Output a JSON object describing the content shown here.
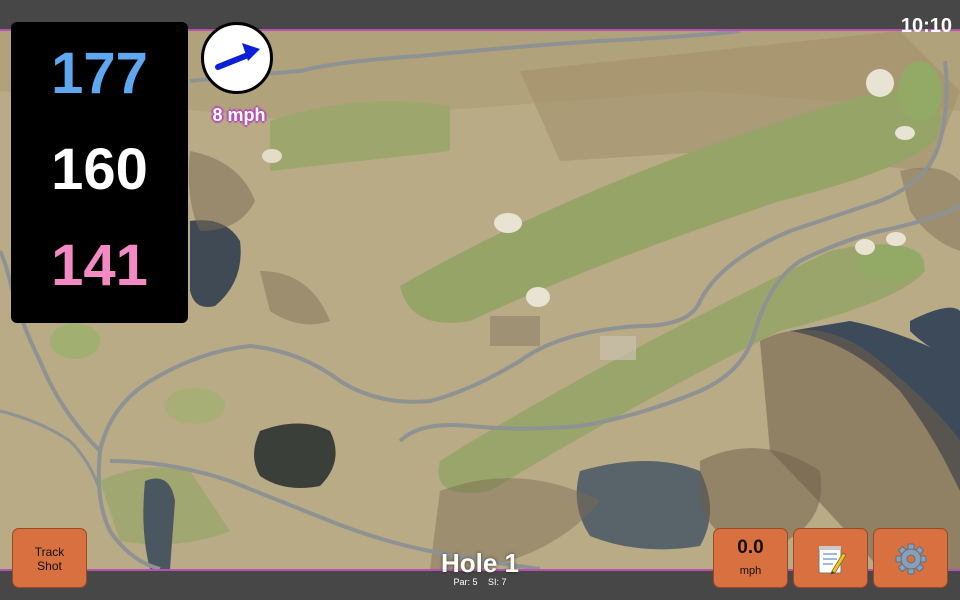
{
  "clock": "10:10",
  "distances": {
    "back": "177",
    "middle": "160",
    "front": "141"
  },
  "wind": {
    "speed_label": "8 mph",
    "direction_icon": "arrow-east-northeast-icon",
    "arrow_color": "#0b1fd8"
  },
  "buttons": {
    "track_shot_line1": "Track",
    "track_shot_line2": "Shot",
    "wind_value": "0.0",
    "wind_unit": "mph",
    "notes_icon": "notepad-icon",
    "settings_icon": "gear-icon"
  },
  "hole": {
    "title": "Hole 1",
    "par_label": "Par: 5",
    "si_label": "SI: 7"
  },
  "colors": {
    "accent": "#b84fb3",
    "button": "#d9703f",
    "back_distance": "#5fa8f0",
    "middle_distance": "#ffffff",
    "front_distance": "#f48ac4"
  }
}
